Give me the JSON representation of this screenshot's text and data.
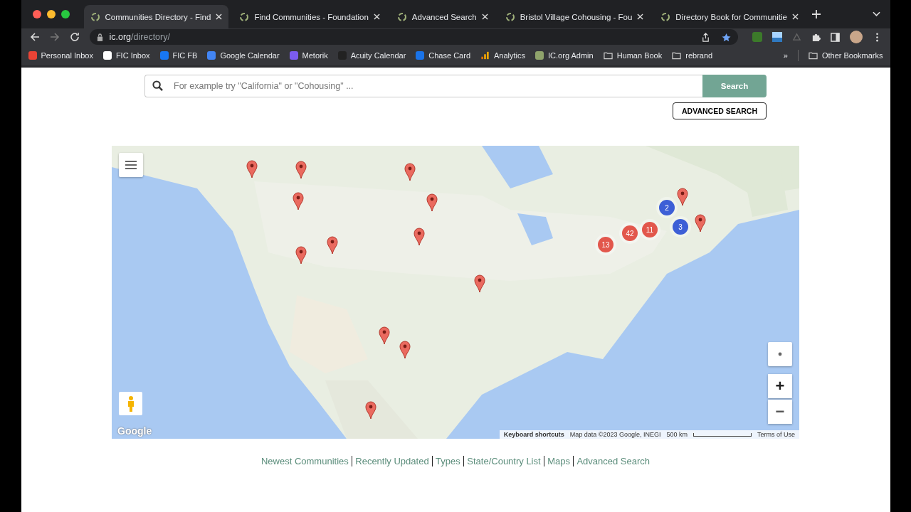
{
  "tabs": [
    {
      "title": "Communities Directory - Find",
      "selected": true
    },
    {
      "title": "Find Communities - Foundation",
      "selected": false
    },
    {
      "title": "Advanced Search",
      "selected": false
    },
    {
      "title": "Bristol Village Cohousing - Fou",
      "selected": false
    },
    {
      "title": "Directory Book for Communitie",
      "selected": false
    }
  ],
  "address": {
    "host": "ic.org",
    "path": "/directory/"
  },
  "bookmarks": [
    {
      "label": "Personal Inbox",
      "kind": "mail"
    },
    {
      "label": "FIC Inbox",
      "kind": "g"
    },
    {
      "label": "FIC FB",
      "kind": "fb"
    },
    {
      "label": "Google Calendar",
      "kind": "cal"
    },
    {
      "label": "Metorik",
      "kind": "bars"
    },
    {
      "label": "Acuity Calendar",
      "kind": "acuity"
    },
    {
      "label": "Chase Card",
      "kind": "chase"
    },
    {
      "label": "Analytics",
      "kind": "analytics"
    },
    {
      "label": "IC.org Admin",
      "kind": "swirl"
    },
    {
      "label": "Human Book",
      "kind": "folder"
    },
    {
      "label": "rebrand",
      "kind": "folder"
    }
  ],
  "more_bookmarks": "»",
  "other_bookmarks": "Other Bookmarks",
  "search": {
    "placeholder": "For example try \"California\" or \"Cohousing\" ...",
    "button": "Search",
    "advanced": "ADVANCED SEARCH"
  },
  "map": {
    "markers": [
      {
        "kind": "pin"
      },
      {
        "kind": "pin"
      },
      {
        "kind": "pin"
      },
      {
        "kind": "pin"
      },
      {
        "kind": "pin"
      },
      {
        "kind": "pin"
      },
      {
        "kind": "pin"
      },
      {
        "kind": "pin"
      },
      {
        "kind": "pin"
      },
      {
        "kind": "pin"
      },
      {
        "kind": "pin"
      },
      {
        "kind": "pin"
      },
      {
        "kind": "pin"
      },
      {
        "kind": "pin"
      },
      {
        "kind": "cluster",
        "count": "2",
        "color": "#3d5fd6"
      },
      {
        "kind": "cluster",
        "count": "3",
        "color": "#3d5fd6"
      },
      {
        "kind": "cluster",
        "count": "42",
        "color": "#e2574c"
      },
      {
        "kind": "cluster",
        "count": "11",
        "color": "#e2574c"
      },
      {
        "kind": "cluster",
        "count": "13",
        "color": "#e2574c"
      }
    ],
    "logo": "Google",
    "shortcuts": "Keyboard shortcuts",
    "attribution": "Map data ©2023 Google, INEGI",
    "scale": "500 km",
    "terms": "Terms of Use",
    "zoom_in": "+",
    "zoom_out": "−"
  },
  "footer_links": [
    "Newest Communities",
    "Recently Updated",
    "Types",
    "State/Country List",
    "Maps",
    "Advanced Search"
  ]
}
